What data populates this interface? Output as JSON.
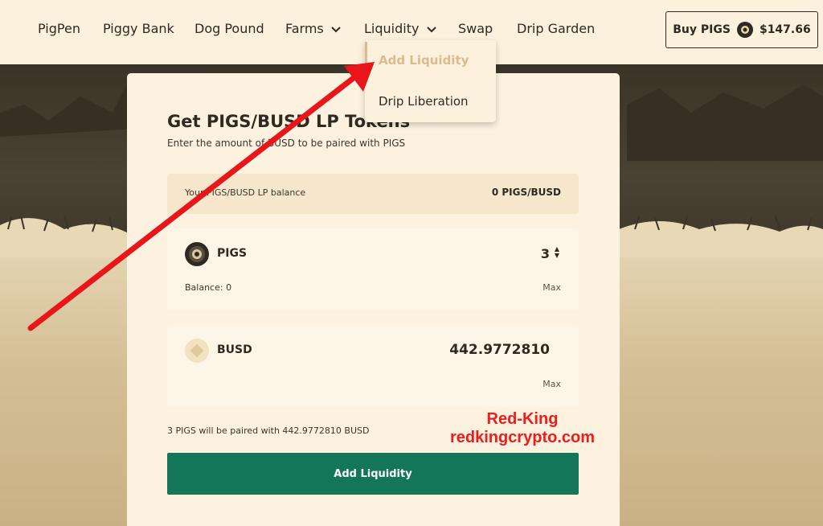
{
  "nav": {
    "items": [
      {
        "label": "PigPen"
      },
      {
        "label": "Piggy Bank"
      },
      {
        "label": "Dog Pound"
      },
      {
        "label": "Farms"
      },
      {
        "label": "Liquidity"
      },
      {
        "label": "Swap"
      },
      {
        "label": "Drip Garden"
      }
    ],
    "buy_label": "Buy PIGS",
    "price": "$147.66"
  },
  "dropdown": {
    "items": [
      {
        "label": "Add Liquidity",
        "active": true
      },
      {
        "label": "Drip Liberation",
        "active": false
      }
    ]
  },
  "card": {
    "title": "Get PIGS/BUSD LP Tokens",
    "subtitle": "Enter the amount of BUSD to be paired with PIGS",
    "balance_label": "Your PIGS/BUSD LP balance",
    "balance_value": "0 PIGS/BUSD",
    "pigs": {
      "name": "PIGS",
      "amount": "3",
      "balance": "Balance: 0",
      "max": "Max"
    },
    "busd": {
      "name": "BUSD",
      "amount": "442.9772810",
      "max": "Max"
    },
    "paired_note": "3 PIGS will be paired with 442.9772810 BUSD",
    "add_button": "Add Liquidity"
  },
  "watermark": {
    "line1": "Red-King",
    "line2": "redkingcrypto.com"
  },
  "colors": {
    "primary_green": "#137659",
    "arrow_red": "#e8151a",
    "cream": "#fcf1dd"
  }
}
